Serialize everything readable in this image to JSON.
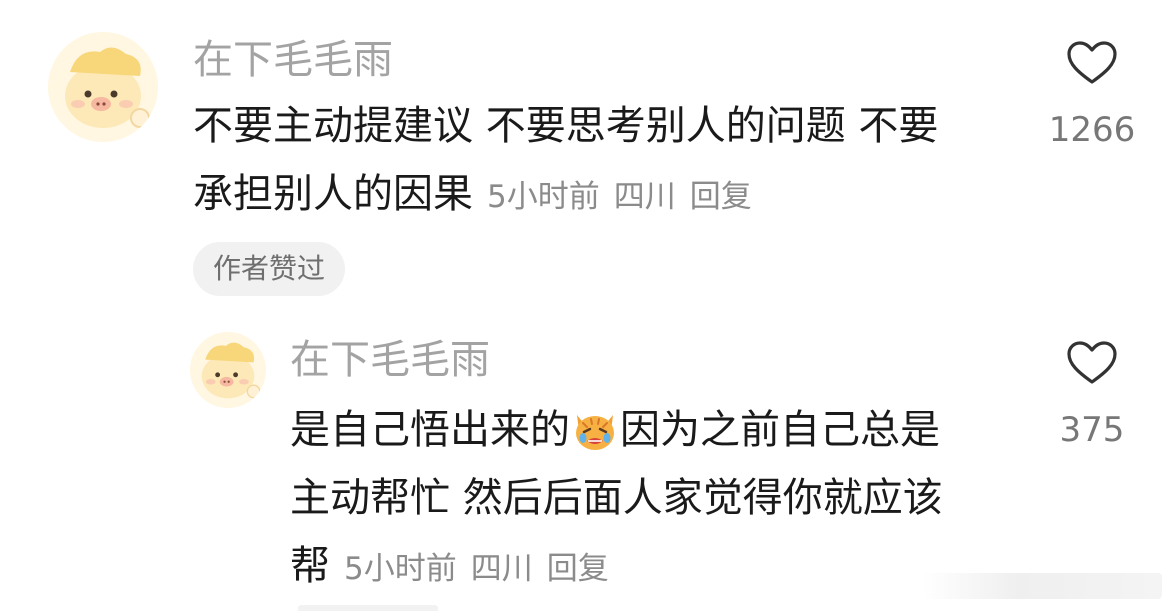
{
  "comments": [
    {
      "username": "在下毛毛雨",
      "text_lines": [
        "不要主动提建议 不要思考别人的问题 不要",
        "承担别人的因果"
      ],
      "time": "5小时前",
      "location": "四川",
      "reply_label": "回复",
      "badge": "作者赞过",
      "likes": "1266",
      "avatar_icon": "cartoon-pig-avatar"
    },
    {
      "username": "在下毛毛雨",
      "text_lines": [
        "是自己悟出来的",
        "因为之前自己总是",
        "主动帮忙 然后后面人家觉得你就应该",
        "帮"
      ],
      "emoji_icon": "crying-cat-emoji",
      "time": "5小时前",
      "location": "四川",
      "reply_label": "回复",
      "likes": "375",
      "avatar_icon": "cartoon-pig-avatar"
    }
  ],
  "colors": {
    "username": "#a3a3a3",
    "text": "#1a1a1a",
    "meta": "#8b8b8b",
    "badge_bg": "#f1f1f1",
    "heart_outline": "#333333"
  }
}
